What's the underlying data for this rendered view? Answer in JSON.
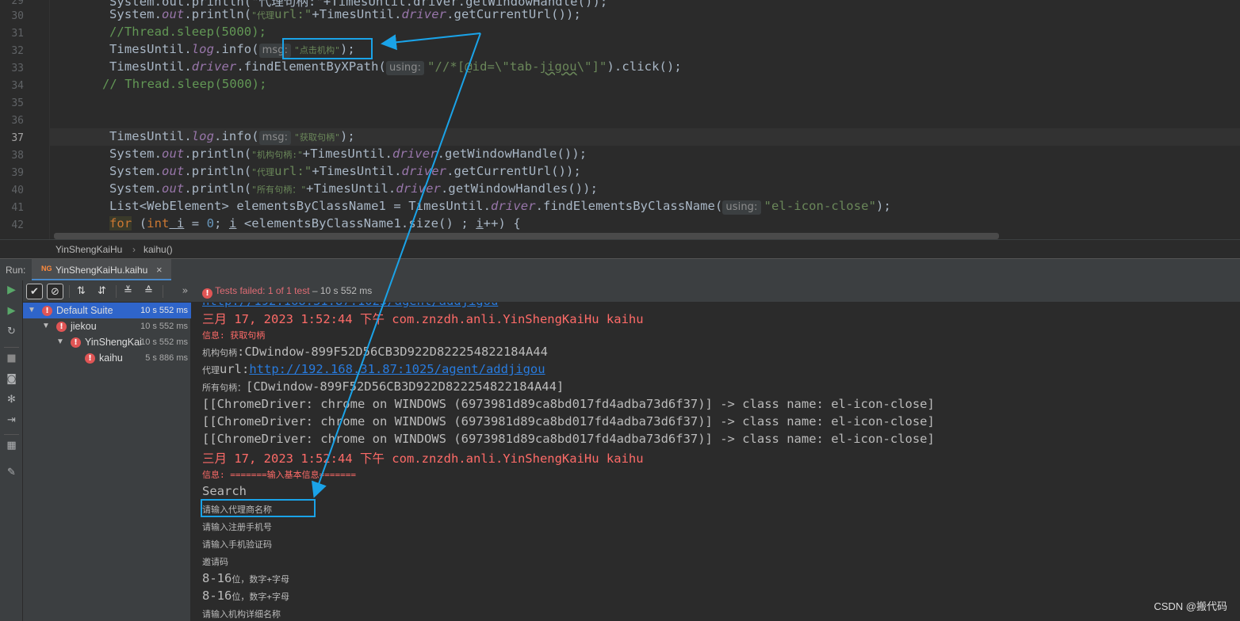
{
  "editor": {
    "line_numbers": [
      "29",
      "30",
      "31",
      "32",
      "33",
      "34",
      "35",
      "36",
      "37",
      "38",
      "39",
      "40",
      "41",
      "42"
    ],
    "lines": {
      "l29": "System.out.println(\"代理句柄:\"+TimesUntil.driver.getWindowHandle());",
      "l30a": "System.",
      "l30b": "out",
      "l30c": ".println(",
      "l30d": "\"代理",
      "l30e": "url:\"",
      "l30f": "+TimesUntil.",
      "l30g": "driver",
      "l30h": ".getCurrentUrl());",
      "l31": "//Thread.sleep(5000);",
      "l32a": "TimesUntil.",
      "l32b": "log",
      "l32c": ".info(",
      "l32hint": "msg:",
      "l32d": "\"点击机构\"",
      "l32e": ");",
      "l33a": "TimesUntil.",
      "l33b": "driver",
      "l33c": ".findElementByXPath(",
      "l33hint": "using:",
      "l33d": "\"//*[@id=\\\"tab-",
      "l33e": "jigou",
      "l33f": "\\\"]\"",
      "l33g": ").click();",
      "l34": "// Thread.sleep(5000);",
      "l37a": "TimesUntil.",
      "l37b": "log",
      "l37c": ".info(",
      "l37hint": "msg:",
      "l37d": "\"获取句柄\"",
      "l37e": ");",
      "l38a": "System.",
      "l38b": "out",
      "l38c": ".println(",
      "l38d": "\"机构句柄:\"",
      "l38e": "+TimesUntil.",
      "l38f": "driver",
      "l38g": ".getWindowHandle());",
      "l39d": "\"代理",
      "l39e": "url:\"",
      "l39g": ".getCurrentUrl());",
      "l40d": "\"所有句柄：\"",
      "l40g": ".getWindowHandles());",
      "l41a": "List<WebElement> elementsByClassName1 = TimesUntil.",
      "l41b": "driver",
      "l41c": ".findElementsByClassName(",
      "l41hint": "using:",
      "l41d": "\"el-icon-close\"",
      "l41e": ");",
      "l42a": "for",
      "l42b": " (",
      "l42c": "int",
      "l42d": " i",
      "l42e": " = ",
      "l42f": "0",
      "l42g": "; ",
      "l42h": "i",
      "l42i": " <elementsByClassName1.size() ; ",
      "l42j": "i",
      "l42k": "++) {"
    }
  },
  "breadcrumb": {
    "class_name": "YinShengKaiHu",
    "method": "kaihu()"
  },
  "run": {
    "label": "Run:",
    "tab_title": "YinShengKaiHu.kaihu",
    "tab_close": "×",
    "status_prefix": "Tests failed: ",
    "status_count": "1 of 1 test",
    "status_time": " – 10 s 552 ms"
  },
  "tree": [
    {
      "name": "Default Suite",
      "time": "10 s 552 ms"
    },
    {
      "name": "jiekou",
      "time": "10 s 552 ms"
    },
    {
      "name": "YinShengKai",
      "time": "10 s 552 ms"
    },
    {
      "name": "kaihu",
      "time": "5 s 886 ms"
    }
  ],
  "console": {
    "log1_date": "三月 17, 2023 1:52:44 下午 com.znzdh.anli.YinShengKaiHu kaihu",
    "info1": "信息: 获取句柄",
    "handle_label": "机构句柄",
    "handle_value": ":CDwindow-899F52D56CB3D922D822254822184A44",
    "url_label": "代理",
    "url_prefix": "url:",
    "url_link": "http://192.168.31.87:1025/agent/addjigou",
    "all_label": "所有句柄：",
    "all_value": "[CDwindow-899F52D56CB3D922D822254822184A44]",
    "chrome1": "[[ChromeDriver: chrome on WINDOWS (6973981d89ca8bd017fd4adba73d6f37)] -> class name: el-icon-close]",
    "chrome2": "[[ChromeDriver: chrome on WINDOWS (6973981d89ca8bd017fd4adba73d6f37)] -> class name: el-icon-close]",
    "chrome3": "[[ChromeDriver: chrome on WINDOWS (6973981d89ca8bd017fd4adba73d6f37)] -> class name: el-icon-close]",
    "log2_date": "三月 17, 2023 1:52:44 下午 com.znzdh.anli.YinShengKaiHu kaihu",
    "info2": "信息: =======输入基本信息=======",
    "search": "Search",
    "p1": "请输入代理商名称",
    "p2": "请输入注册手机号",
    "p3": "请输入手机验证码",
    "p4": "邀请码",
    "p5a": "8-16",
    "p5b": "位，数字+字母",
    "p6a": "8-16",
    "p6b": "位，数字+字母",
    "p7": "请输入机构详细名称"
  },
  "watermark": "CSDN @搬代码",
  "colors": {
    "accent": "#1aa3e8",
    "fail": "#e05555",
    "selection": "#2f65ca",
    "run_bar": "#4a0a7a"
  }
}
